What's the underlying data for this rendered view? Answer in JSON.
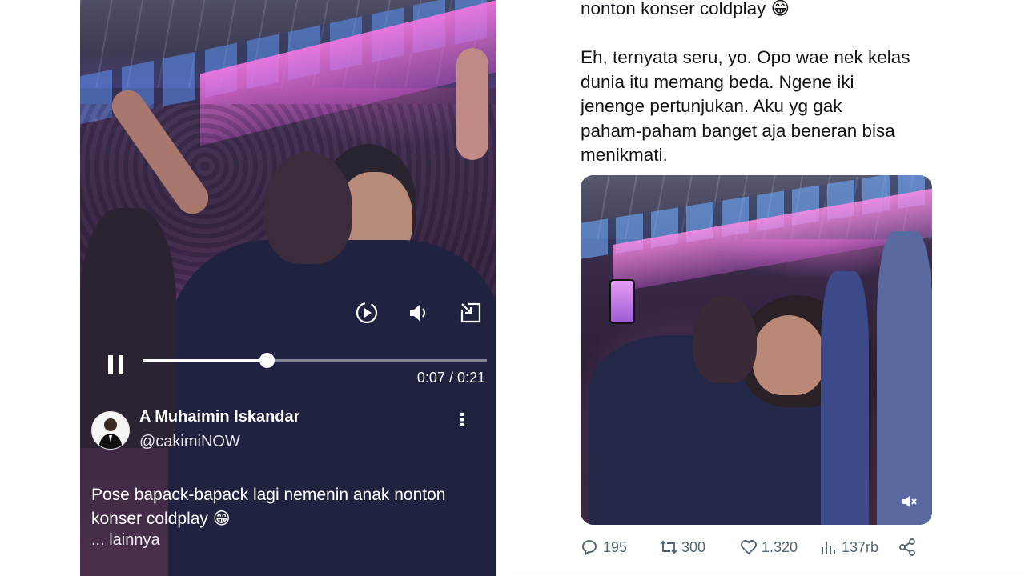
{
  "left_video": {
    "time": "0:07 / 0:21",
    "progress": 0.36,
    "author": {
      "name": "A Muhaimin Iskandar",
      "handle": "@cakimiNOW"
    },
    "caption_line1": "Pose bapack-bapack lagi nemenin anak nonton",
    "caption_line2": "konser coldplay 😁",
    "more_label": "... lainnya",
    "kebab": "⋮"
  },
  "tweet": {
    "line_top": "nonton konser coldplay 😁",
    "para": [
      "Eh, ternyata seru, yo. Opo wae nek kelas",
      "dunia itu memang beda. Ngene iki",
      "jenenge pertunjukan. Aku yg gak",
      "paham-paham banget aja beneran bisa",
      "menikmati."
    ],
    "actions": {
      "replies": "195",
      "reposts": "300",
      "likes": "1.320",
      "views": "137rb"
    }
  }
}
